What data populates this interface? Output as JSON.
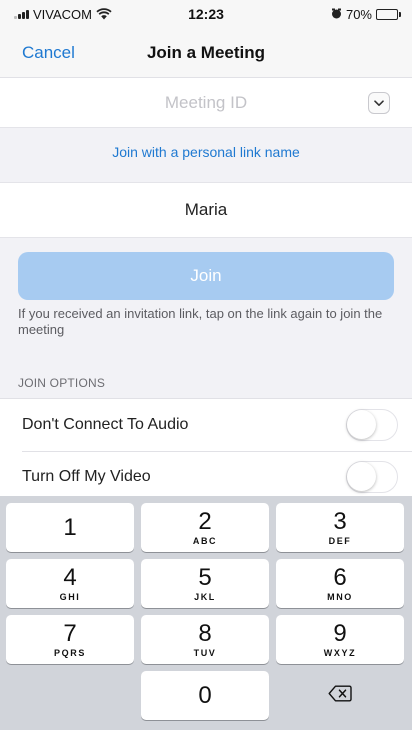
{
  "status_bar": {
    "carrier": "VIVACOM",
    "time": "12:23",
    "battery": "70%",
    "battery_level": 0.7
  },
  "nav": {
    "cancel_label": "Cancel",
    "title": "Join a Meeting"
  },
  "meeting_id": {
    "placeholder": "Meeting ID",
    "value": ""
  },
  "personal_link_label": "Join with a personal link name",
  "name_field": {
    "value": "Maria"
  },
  "join_label": "Join",
  "info_text": "If you received an invitation link, tap on the link again to join the meeting",
  "join_options": {
    "header": "JOIN OPTIONS",
    "items": [
      {
        "label": "Don't Connect To Audio",
        "on": false
      },
      {
        "label": "Turn Off My Video",
        "on": false
      }
    ]
  },
  "keypad": {
    "keys": [
      {
        "digit": "1",
        "letters": ""
      },
      {
        "digit": "2",
        "letters": "ABC"
      },
      {
        "digit": "3",
        "letters": "DEF"
      },
      {
        "digit": "4",
        "letters": "GHI"
      },
      {
        "digit": "5",
        "letters": "JKL"
      },
      {
        "digit": "6",
        "letters": "MNO"
      },
      {
        "digit": "7",
        "letters": "PQRS"
      },
      {
        "digit": "8",
        "letters": "TUV"
      },
      {
        "digit": "9",
        "letters": "WXYZ"
      },
      {
        "digit": "0",
        "letters": ""
      }
    ]
  },
  "colors": {
    "accent": "#1f79d1",
    "join_button_disabled": "#a7cbf1",
    "keypad_background": "#d1d4da"
  }
}
